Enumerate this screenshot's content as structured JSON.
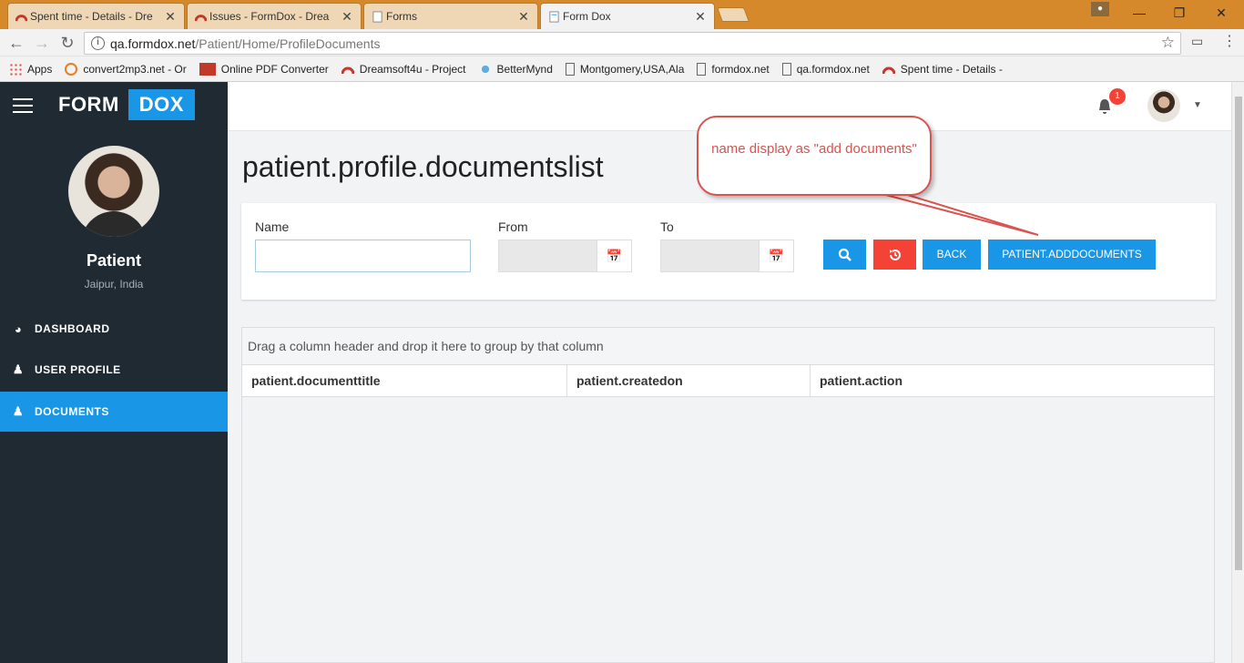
{
  "browser": {
    "tabs": [
      {
        "title": "Spent time - Details - Dre",
        "close": "✕"
      },
      {
        "title": "Issues - FormDox - Drea",
        "close": "✕"
      },
      {
        "title": "Forms",
        "close": "✕"
      },
      {
        "title": "Form Dox",
        "close": "✕"
      }
    ],
    "url_host": "qa.formdox.net",
    "url_path": "/Patient/Home/ProfileDocuments",
    "bookmarks": [
      {
        "label": "Apps",
        "icon": "apps-icon"
      },
      {
        "label": "convert2mp3.net - Or",
        "icon": "convert-icon"
      },
      {
        "label": "Online PDF Converter",
        "icon": "pdf-icon"
      },
      {
        "label": "Dreamsoft4u - Project",
        "icon": "redmine-icon"
      },
      {
        "label": "BetterMynd",
        "icon": "bulb-icon"
      },
      {
        "label": "Montgomery,USA,Ala",
        "icon": "page-icon"
      },
      {
        "label": "formdox.net",
        "icon": "page-icon"
      },
      {
        "label": "qa.formdox.net",
        "icon": "page-icon"
      },
      {
        "label": "Spent time - Details -",
        "icon": "redmine-icon"
      }
    ]
  },
  "app": {
    "logo_left": "FORM",
    "logo_right": "DOX",
    "user": {
      "name": "Patient",
      "location": "Jaipur, India"
    },
    "nav": [
      {
        "label": "DASHBOARD",
        "icon": "dashboard-icon"
      },
      {
        "label": "USER PROFILE",
        "icon": "users-icon"
      },
      {
        "label": "DOCUMENTS",
        "icon": "users-icon"
      }
    ],
    "notifications_count": "1"
  },
  "page": {
    "title": "patient.profile.documentslist",
    "filters": {
      "name_label": "Name",
      "name_value": "",
      "from_label": "From",
      "to_label": "To"
    },
    "buttons": {
      "back": "BACK",
      "add_documents": "PATIENT.ADDDOCUMENTS"
    },
    "grid": {
      "group_hint": "Drag a column header and drop it here to group by that column",
      "columns": [
        "patient.documenttitle",
        "patient.createdon",
        "patient.action"
      ]
    }
  },
  "annotation": {
    "text": "name display as \"add documents\""
  },
  "colors": {
    "accent": "#1a96e6",
    "danger": "#f44336",
    "sidebar": "#1f2a33",
    "callout": "#d9534f"
  }
}
